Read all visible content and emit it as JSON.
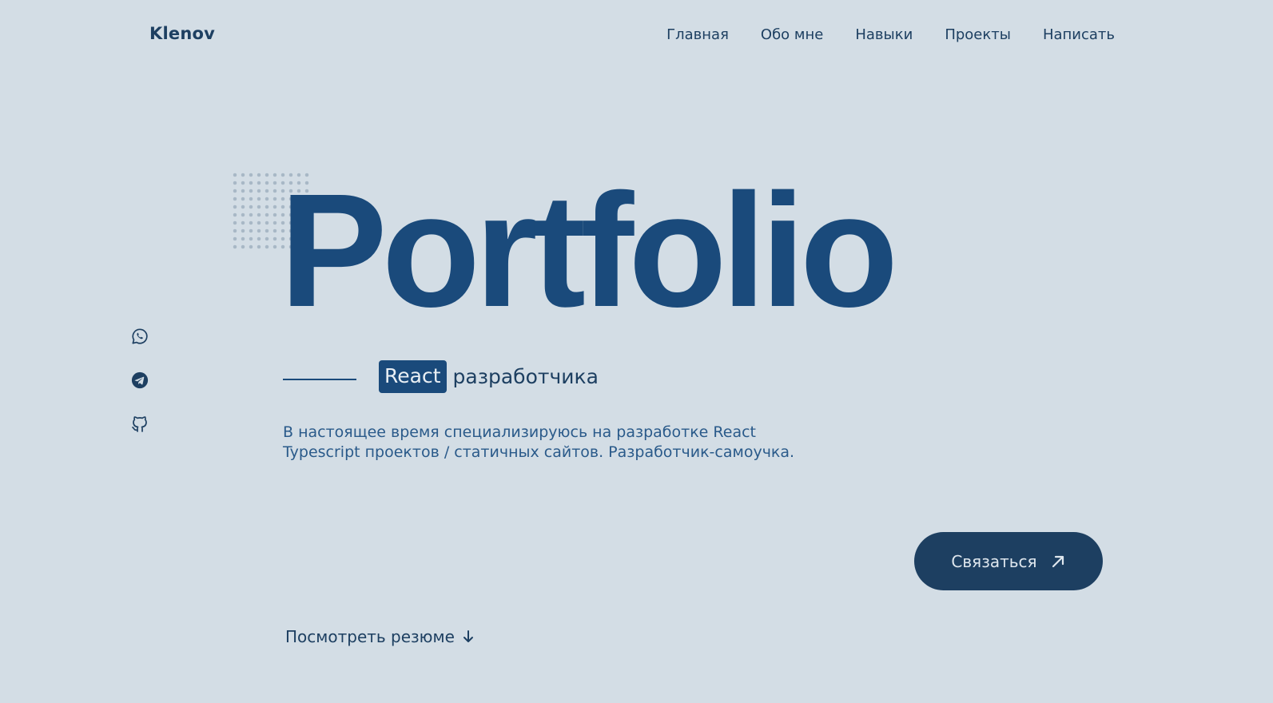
{
  "header": {
    "logo": "Klenov",
    "nav": [
      "Главная",
      "Обо мне",
      "Навыки",
      "Проекты",
      "Написать"
    ]
  },
  "hero": {
    "title": "Portfolio",
    "badge": "React",
    "subtitle": "разработчика",
    "description": "В настоящее время специализируюсь на разработке React Typescript проектов / статичных сайтов. Разработчик-самоучка."
  },
  "social": {
    "icons": [
      "whatsapp-icon",
      "telegram-icon",
      "github-icon"
    ]
  },
  "actions": {
    "contact_label": "Связаться",
    "resume_label": "Посмотреть резюме"
  },
  "colors": {
    "background": "#d3dde5",
    "primary": "#1a4a7b",
    "dark": "#1d3f61"
  }
}
